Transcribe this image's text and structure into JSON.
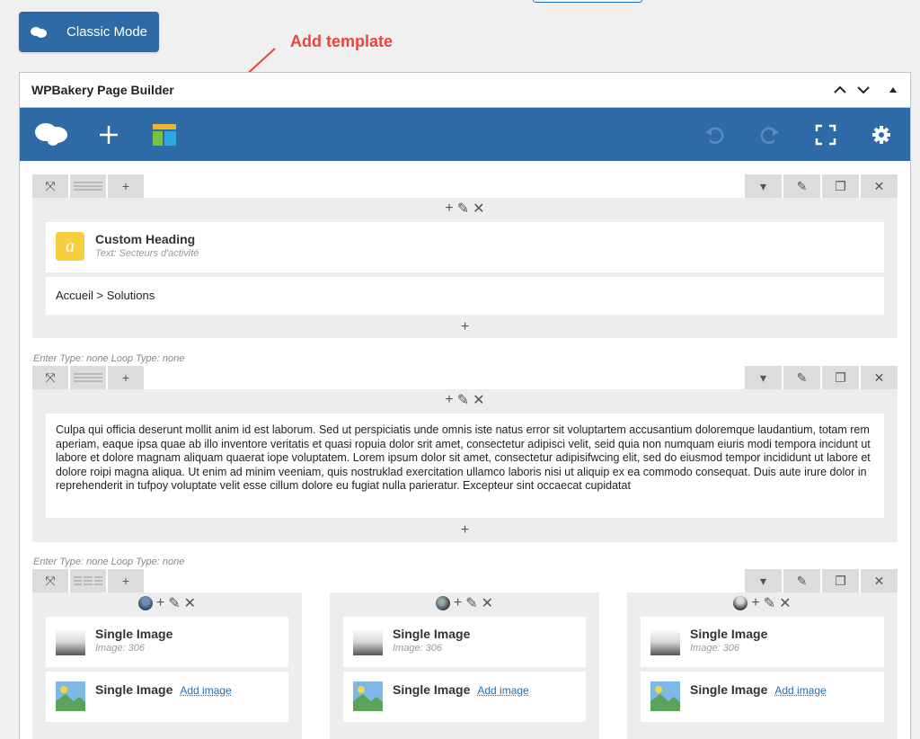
{
  "classic_mode": {
    "label": "Classic Mode"
  },
  "annotation": {
    "text": "Add template",
    "color": "#e8463a"
  },
  "panel": {
    "title": "WPBakery Page Builder",
    "toolbar_color": "#2e6aa6"
  },
  "rows": [
    {
      "elements": [
        {
          "title": "Custom Heading",
          "subtitle": "Text: Secteurs d'activité",
          "icon": "custom-heading-icon"
        },
        {
          "text": "Accueil > Solutions"
        }
      ]
    },
    {
      "meta": "Enter Type: none  Loop Type: none",
      "paragraph": "Culpa qui officia deserunt mollit anim id est laborum. Sed ut perspiciatis unde omnis iste natus error sit voluptartem accusantium doloremque laudantium, totam rem aperiam, eaque ipsa quae ab illo inventore veritatis et quasi ropuia dolor srit amet, consectetur adipisci velit, seid quia non numquam eiuris modi tempora incidunt ut labore et dolore magnam aliquam quaerat iope voluptatem. Lorem ipsum dolor sit amet, consectetur adipisifwcing elit, sed do eiusmod tempor incididunt ut labore et dolore roipi magna aliqua. Ut enim ad minim veeniam, quis nostruklad exercitation ullamco laboris nisi ut aliquip ex ea commodo consequat. Duis aute irure dolor in reprehenderit in tufpoy voluptate velit esse cillum dolore eu fugiat nulla parieratur. Excepteur sint occaecat cupidatat"
    },
    {
      "meta": "Enter Type: none  Loop Type: none",
      "columns": [
        {
          "single_image": {
            "title": "Single Image",
            "subtitle": "Image: 306"
          },
          "second": {
            "title": "Single Image",
            "link": "Add image"
          }
        },
        {
          "single_image": {
            "title": "Single Image",
            "subtitle": "Image: 306"
          },
          "second": {
            "title": "Single Image",
            "link": "Add image"
          }
        },
        {
          "single_image": {
            "title": "Single Image",
            "subtitle": "Image: 306"
          },
          "second": {
            "title": "Single Image",
            "link": "Add image"
          }
        }
      ]
    }
  ]
}
